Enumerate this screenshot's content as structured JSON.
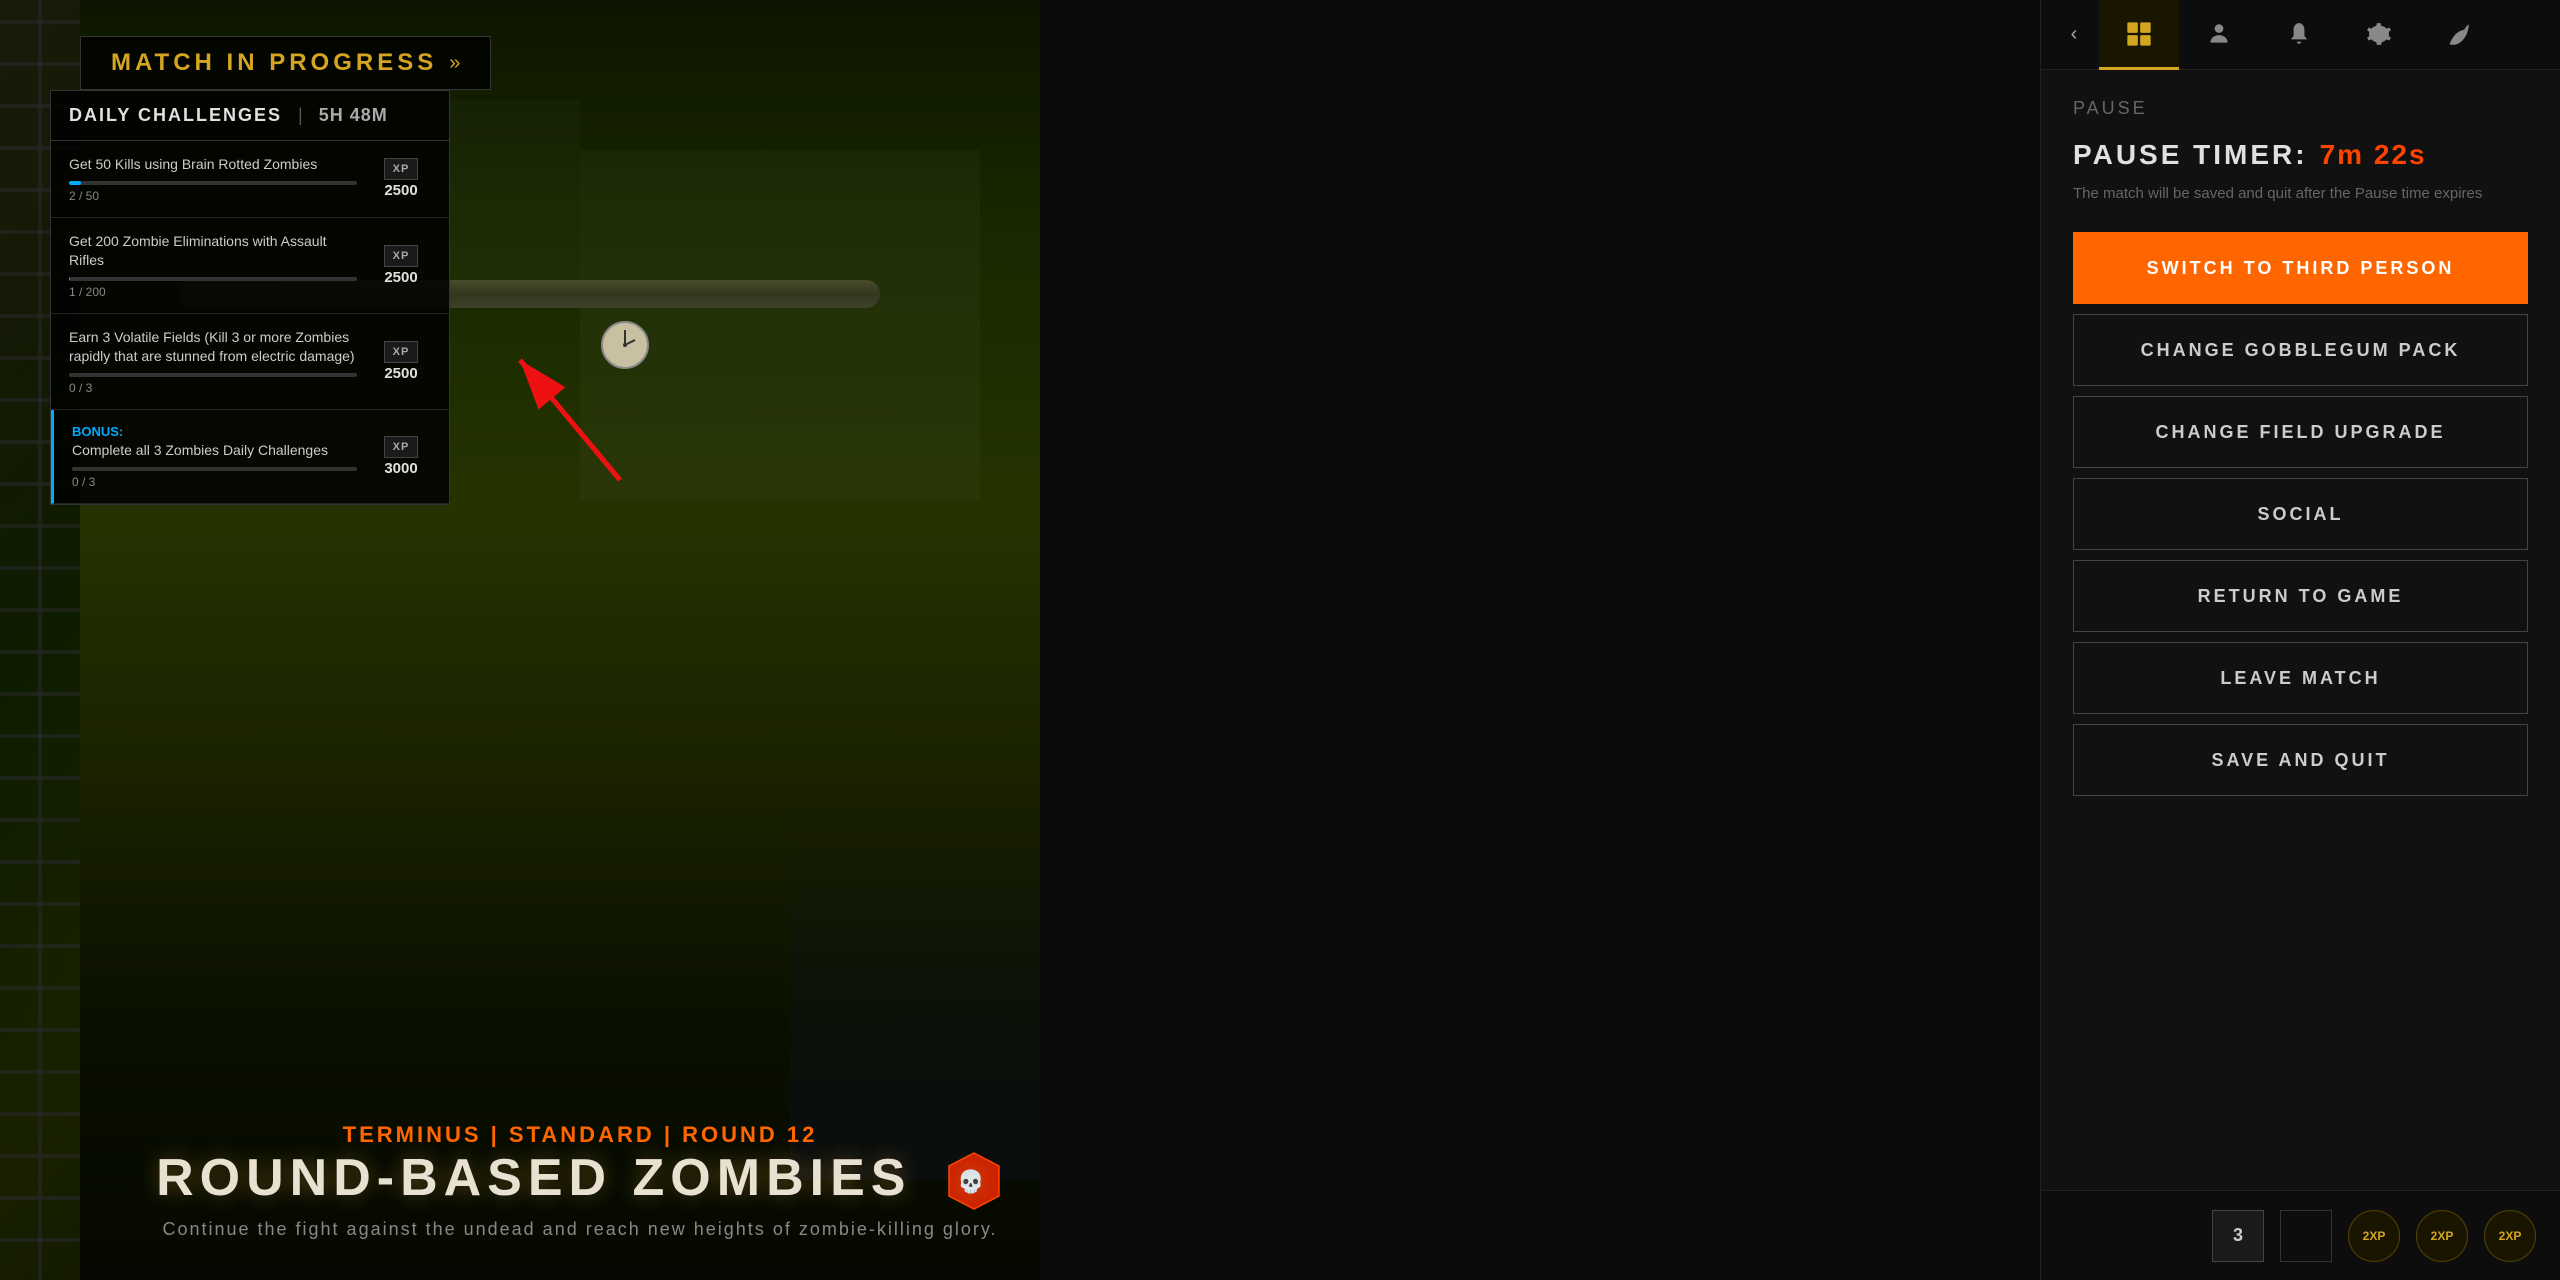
{
  "matchBanner": {
    "text": "MATCH IN PROGRESS",
    "chevrons": "»"
  },
  "challengesPanel": {
    "title": "DAILY CHALLENGES",
    "divider": "|",
    "timer": "5H 48M",
    "challenges": [
      {
        "id": 1,
        "text": "Get 50 Kills using Brain Rotted Zombies",
        "current": 2,
        "total": 50,
        "progressPct": 4,
        "xpLabel": "XP",
        "xpValue": "2500",
        "isBonus": false,
        "bonusLabel": ""
      },
      {
        "id": 2,
        "text": "Get 200 Zombie Eliminations with Assault Rifles",
        "current": 1,
        "total": 200,
        "progressPct": 0.5,
        "xpLabel": "XP",
        "xpValue": "2500",
        "isBonus": false,
        "bonusLabel": ""
      },
      {
        "id": 3,
        "text": "Earn 3 Volatile Fields (Kill 3 or more Zombies rapidly that are stunned from electric damage)",
        "current": 0,
        "total": 3,
        "progressPct": 0,
        "xpLabel": "XP",
        "xpValue": "2500",
        "isBonus": false,
        "bonusLabel": ""
      },
      {
        "id": 4,
        "text": "Complete all 3 Zombies Daily Challenges",
        "current": 0,
        "total": 3,
        "progressPct": 0,
        "xpLabel": "XP",
        "xpValue": "3000",
        "isBonus": true,
        "bonusLabel": "Bonus:"
      }
    ]
  },
  "gameInfo": {
    "modeLabel": "TERMINUS | STANDARD | ROUND 12",
    "modeTitle": "ROUND-BASED ZOMBIES",
    "modeSubtitle": "Continue the fight against the undead and reach new heights of zombie-killing glory."
  },
  "pauseMenu": {
    "label": "PAUSE",
    "timerLabel": "PAUSE TIMER:",
    "timerValue": "7m 22s",
    "timerDesc": "The match will be saved and quit after the Pause time expires",
    "buttons": [
      {
        "id": "switch-person",
        "label": "SWITCH TO THIRD PERSON",
        "style": "primary"
      },
      {
        "id": "change-gobblegum",
        "label": "CHANGE GOBBLEGUM PACK",
        "style": "secondary"
      },
      {
        "id": "change-field-upgrade",
        "label": "CHANGE FIELD UPGRADE",
        "style": "secondary"
      },
      {
        "id": "social",
        "label": "SOCIAL",
        "style": "secondary"
      },
      {
        "id": "return-game",
        "label": "RETURN TO GAME",
        "style": "secondary"
      },
      {
        "id": "leave-match",
        "label": "LEAVE MATCH",
        "style": "secondary"
      },
      {
        "id": "save-quit",
        "label": "SAVE AND QUIT",
        "style": "secondary"
      }
    ]
  },
  "navTabs": [
    {
      "id": "grid",
      "icon": "⊞",
      "active": true
    },
    {
      "id": "person",
      "icon": "👤",
      "active": false
    },
    {
      "id": "bell",
      "icon": "🔔",
      "active": false
    },
    {
      "id": "gear",
      "icon": "⚙",
      "active": false
    },
    {
      "id": "leaf",
      "icon": "🍃",
      "active": false
    }
  ],
  "statusBar": {
    "roundNumber": "3",
    "tokens": [
      "2XP",
      "2XP",
      "2XP"
    ]
  },
  "colors": {
    "orange": "#ff6600",
    "gold": "#d4a520",
    "blue": "#00aaff",
    "red": "#ff4400",
    "darkBg": "#111111",
    "panelBg": "#0d0d0d"
  }
}
